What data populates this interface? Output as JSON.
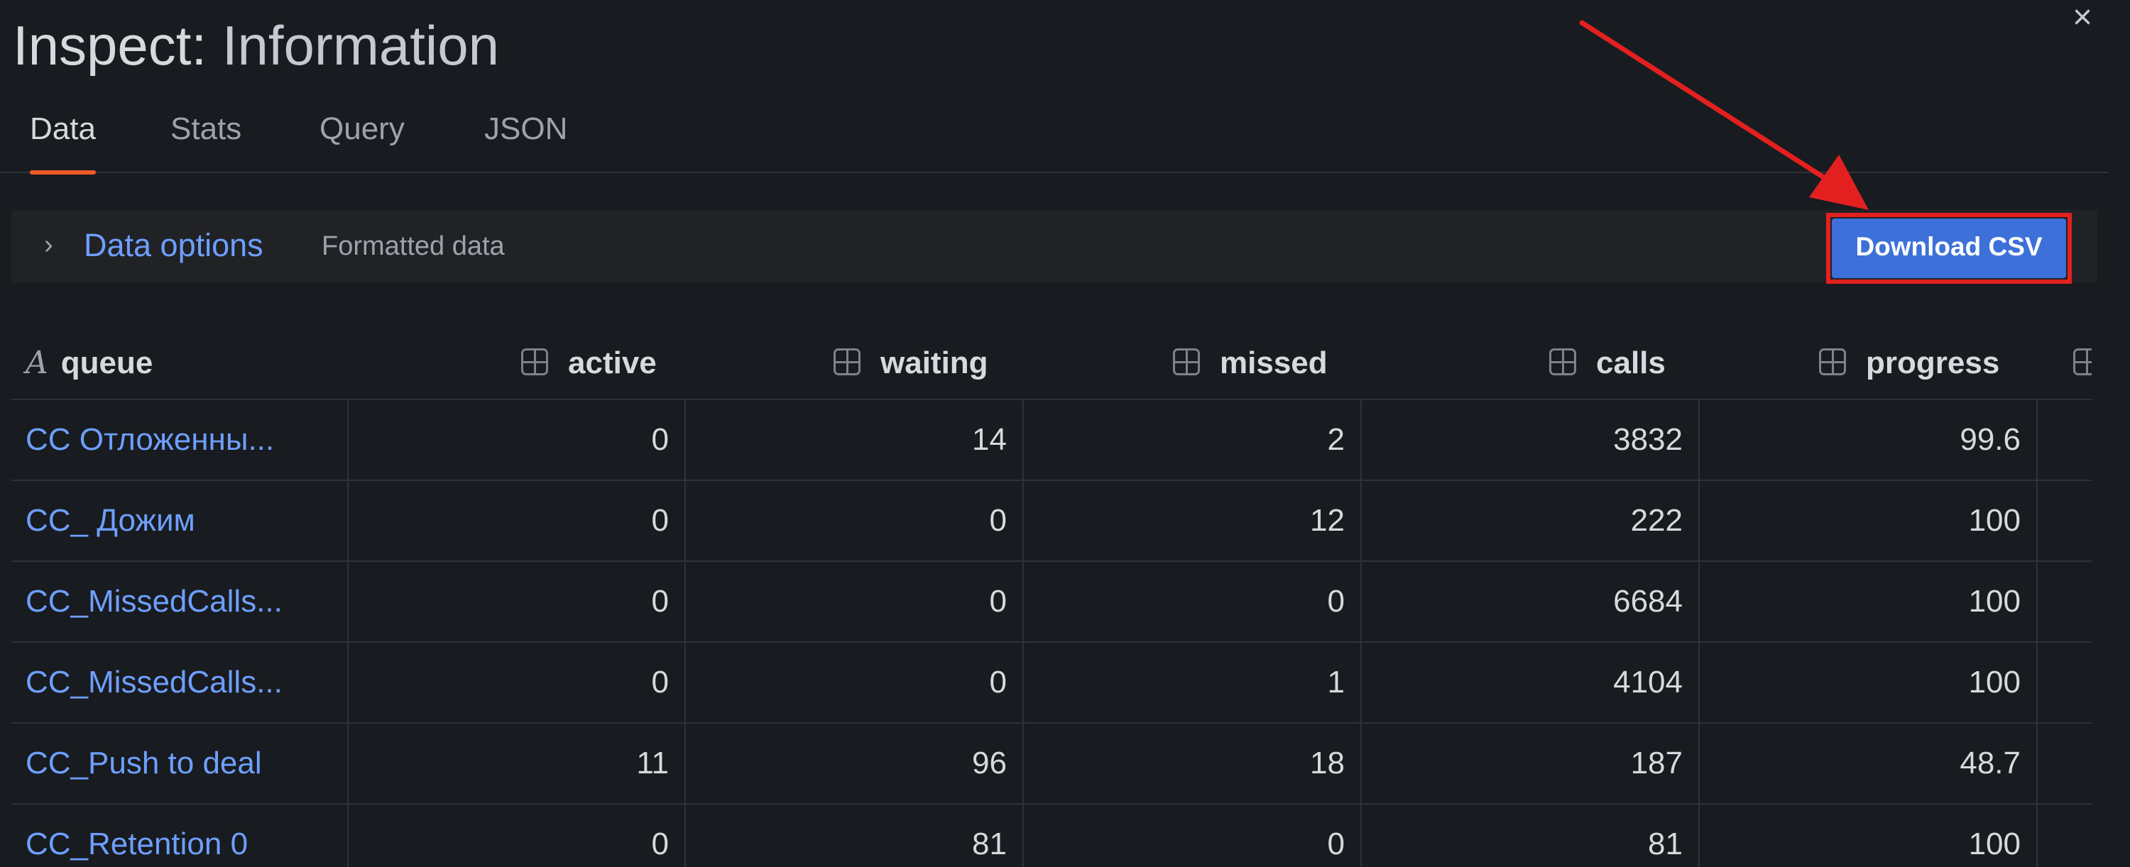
{
  "header": {
    "title_prefix": "Inspect:",
    "title_name": "Information",
    "close_glyph": "×"
  },
  "tabs": [
    {
      "label": "Data",
      "active": true
    },
    {
      "label": "Stats",
      "active": false
    },
    {
      "label": "Query",
      "active": false
    },
    {
      "label": "JSON",
      "active": false
    }
  ],
  "options": {
    "chevron_glyph": "›",
    "label": "Data options",
    "description": "Formatted data",
    "download_label": "Download CSV"
  },
  "table": {
    "columns": [
      "queue",
      "active",
      "waiting",
      "missed",
      "calls",
      "progress"
    ],
    "rows": [
      [
        "CC Отложенны...",
        "0",
        "14",
        "2",
        "3832",
        "99.6"
      ],
      [
        "CC_ Дожим",
        "0",
        "0",
        "12",
        "222",
        "100"
      ],
      [
        "CC_MissedCalls...",
        "0",
        "0",
        "0",
        "6684",
        "100"
      ],
      [
        "CC_MissedCalls...",
        "0",
        "0",
        "1",
        "4104",
        "100"
      ],
      [
        "CC_Push to deal",
        "11",
        "96",
        "18",
        "187",
        "48.7"
      ],
      [
        "CC_Retention 0",
        "0",
        "81",
        "0",
        "81",
        "100"
      ]
    ]
  },
  "colors": {
    "accent_tab": "#f05a28",
    "link": "#6e9fff",
    "button": "#3d71d9",
    "annotation": "#e32020"
  }
}
